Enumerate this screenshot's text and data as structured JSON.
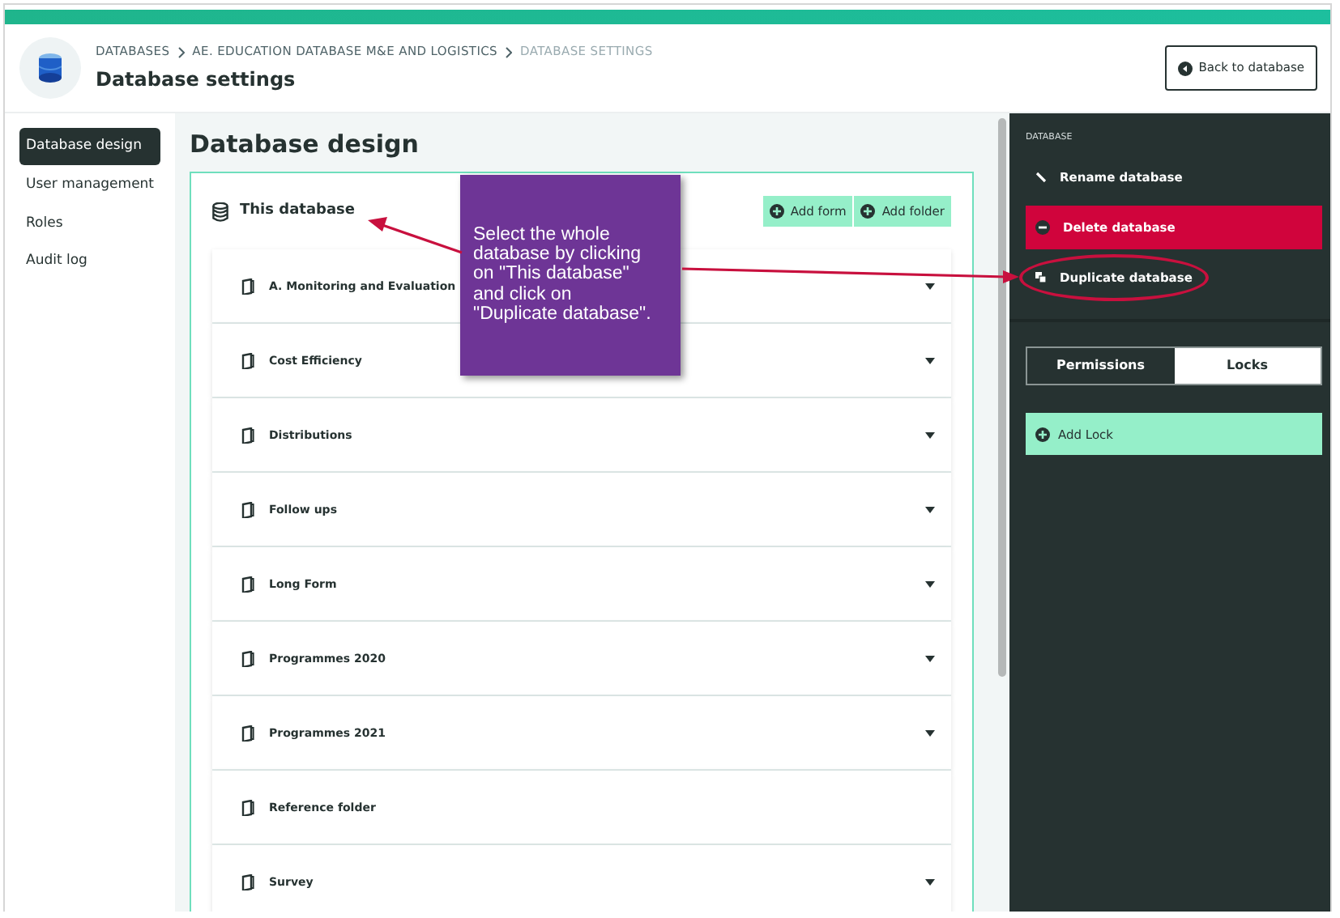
{
  "breadcrumb": [
    {
      "label": "DATABASES",
      "current": false
    },
    {
      "label": "AE. EDUCATION DATABASE M&E AND LOGISTICS",
      "current": false
    },
    {
      "label": "DATABASE SETTINGS",
      "current": true
    }
  ],
  "page_title": "Database settings",
  "back_button": "Back to database",
  "sidebar": {
    "items": [
      {
        "label": "Database design",
        "selected": true
      },
      {
        "label": "User management",
        "selected": false
      },
      {
        "label": "Roles",
        "selected": false
      },
      {
        "label": "Audit log",
        "selected": false
      }
    ]
  },
  "main": {
    "heading": "Database design",
    "root": "This database",
    "actions": [
      "Add form",
      "Add folder"
    ],
    "folders": [
      {
        "label": "A. Monitoring and Evaluation",
        "expandable": true
      },
      {
        "label": "Cost Efficiency",
        "expandable": true
      },
      {
        "label": "Distributions",
        "expandable": true
      },
      {
        "label": "Follow ups",
        "expandable": true
      },
      {
        "label": "Long Form",
        "expandable": true
      },
      {
        "label": "Programmes 2020",
        "expandable": true
      },
      {
        "label": "Programmes 2021",
        "expandable": true
      },
      {
        "label": "Reference folder",
        "expandable": false
      },
      {
        "label": "Survey",
        "expandable": true
      }
    ]
  },
  "panel": {
    "section_label": "DATABASE",
    "actions": [
      {
        "label": "Rename database",
        "kind": "rename",
        "circled": false
      },
      {
        "label": "Delete database",
        "kind": "delete",
        "circled": false
      },
      {
        "label": "Duplicate database",
        "kind": "duplicate",
        "circled": true
      }
    ],
    "tabs": [
      {
        "label": "Permissions",
        "selected": false
      },
      {
        "label": "Locks",
        "selected": true
      }
    ],
    "add_lock": "Add Lock"
  },
  "callout": {
    "text": "Select the whole database by clicking on \"This database\" and click on \"Duplicate database\"."
  }
}
